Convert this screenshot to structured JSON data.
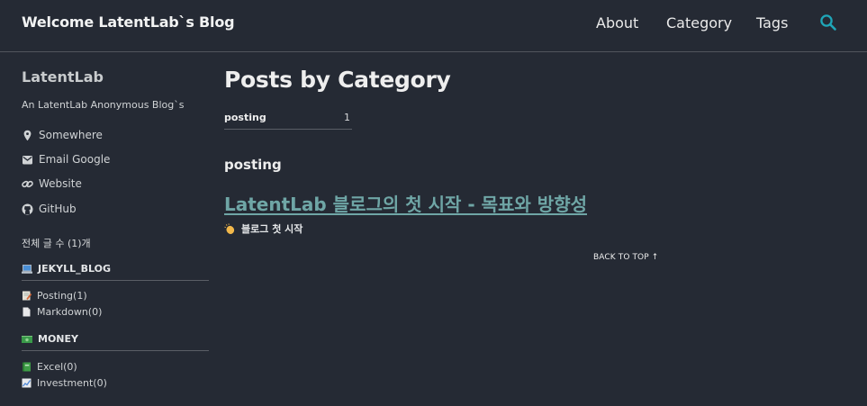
{
  "masthead": {
    "site_title": "Welcome LatentLab`s Blog",
    "nav": [
      "About",
      "Category",
      "Tags"
    ],
    "search_icon": "search-icon",
    "accent_color": "#1fa6b8"
  },
  "sidebar": {
    "author_name": "LatentLab",
    "author_bio": "An LatentLab Anonymous Blog`s",
    "links": [
      {
        "label": "Somewhere",
        "icon": "location-pin-icon"
      },
      {
        "label": "Email Google",
        "icon": "envelope-icon"
      },
      {
        "label": "Website",
        "icon": "link-icon"
      },
      {
        "label": "GitHub",
        "icon": "github-icon"
      }
    ],
    "total_count": "전체 글 수 (1)개",
    "categories": [
      {
        "header": "JEKYLL_BLOG",
        "icon": "laptop-icon",
        "items": [
          {
            "label": "Posting(1)",
            "icon": "memo-icon"
          },
          {
            "label": "Markdown(0)",
            "icon": "page-icon"
          }
        ]
      },
      {
        "header": "MONEY",
        "icon": "money-icon",
        "items": [
          {
            "label": "Excel(0)",
            "icon": "green-book-icon"
          },
          {
            "label": "Investment(0)",
            "icon": "chart-up-icon"
          }
        ]
      }
    ]
  },
  "main": {
    "page_title": "Posts by Category",
    "taxonomy_index": [
      {
        "name": "posting",
        "count": "1"
      }
    ],
    "section_title": "posting",
    "posts": [
      {
        "title": "LatentLab 블로그의 첫 시작 - 목표와 방향성",
        "excerpt": "블로그 첫 시작",
        "excerpt_icon": "clapping-hand-icon"
      }
    ],
    "back_to_top": "BACK TO TOP ↑"
  }
}
